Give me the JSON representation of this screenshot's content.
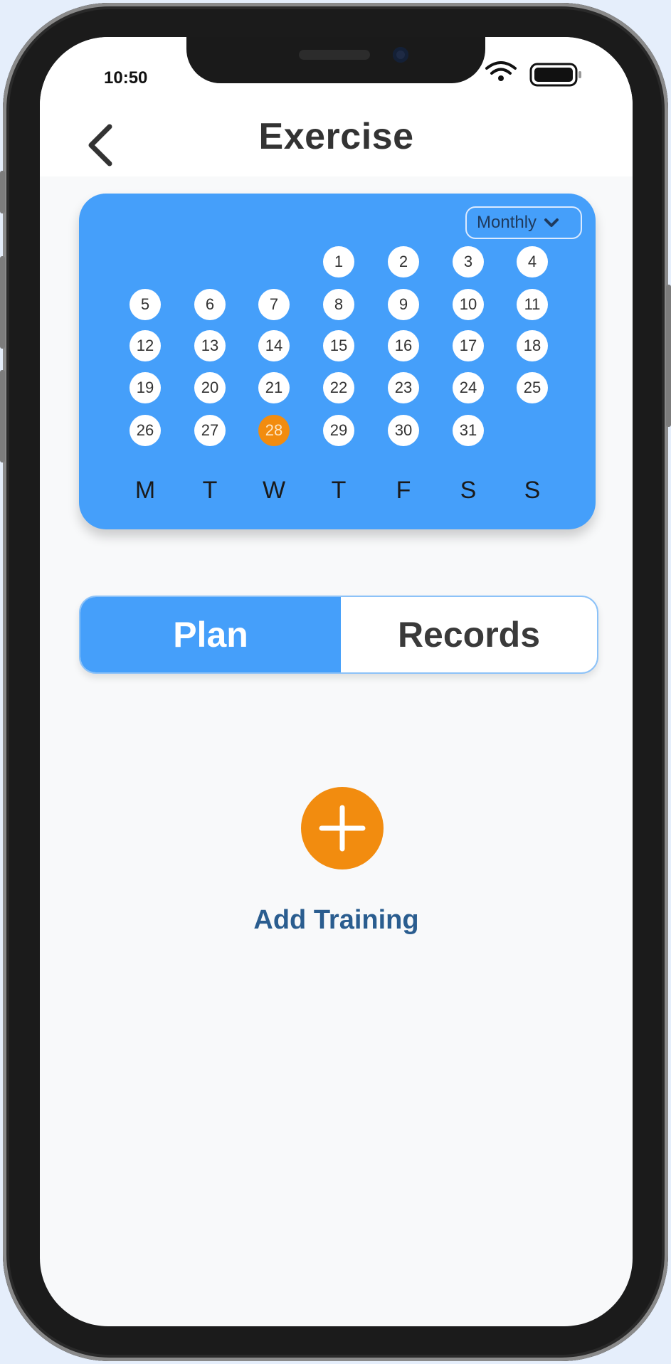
{
  "status_bar": {
    "time": "10:50"
  },
  "header": {
    "title": "Exercise",
    "back_icon": "chevron-left-icon"
  },
  "calendar": {
    "view_select": "Monthly",
    "days": [
      "1",
      "2",
      "3",
      "4",
      "5",
      "6",
      "7",
      "8",
      "9",
      "10",
      "11",
      "12",
      "13",
      "14",
      "15",
      "16",
      "17",
      "18",
      "19",
      "20",
      "21",
      "22",
      "23",
      "24",
      "25",
      "26",
      "27",
      "28",
      "29",
      "30",
      "31"
    ],
    "first_weekday_index": 3,
    "selected_day": "28",
    "weekdays": [
      "M",
      "T",
      "W",
      "T",
      "F",
      "S",
      "S"
    ],
    "colors": {
      "card": "#459ffa",
      "selected": "#f28c0f",
      "day_bg": "#ffffff"
    }
  },
  "tabs": {
    "plan": "Plan",
    "records": "Records",
    "active": "Plan"
  },
  "add_training": {
    "label": "Add Training",
    "icon": "plus-icon",
    "color": "#f28c0f"
  }
}
